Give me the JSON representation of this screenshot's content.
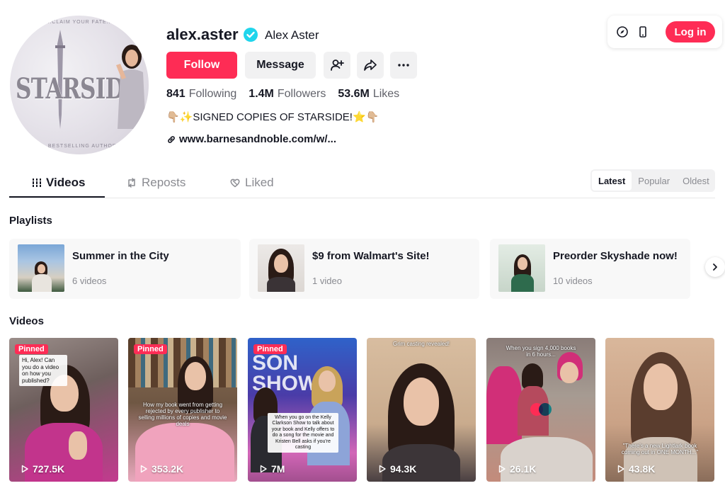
{
  "profile": {
    "username": "alex.aster",
    "nickname": "Alex Aster",
    "avatar_text": {
      "top": "...CLAIM YOUR FATE...",
      "title": "STARSIDE",
      "bottom": "...BESTSELLING AUTHOR"
    },
    "verified_icon": "verified-badge-icon",
    "follow_label": "Follow",
    "message_label": "Message",
    "stats": [
      {
        "value": "841",
        "label": "Following"
      },
      {
        "value": "1.4M",
        "label": "Followers"
      },
      {
        "value": "53.6M",
        "label": "Likes"
      }
    ],
    "bio": "👇🏼✨SIGNED COPIES OF STARSIDE!⭐👇🏼",
    "link": "www.barnesandnoble.com/w/..."
  },
  "topbar": {
    "login_label": "Log in"
  },
  "tabs": [
    {
      "label": "Videos",
      "active": true
    },
    {
      "label": "Reposts",
      "active": false
    },
    {
      "label": "Liked",
      "active": false
    }
  ],
  "sort": [
    {
      "label": "Latest",
      "active": true
    },
    {
      "label": "Popular",
      "active": false
    },
    {
      "label": "Oldest",
      "active": false
    }
  ],
  "sections": {
    "playlists": "Playlists",
    "videos": "Videos"
  },
  "playlists": [
    {
      "name": "Summer in the City",
      "count": "6 videos"
    },
    {
      "name": "$9 from Walmart's Site!",
      "count": "1 video"
    },
    {
      "name": "Preorder Skyshade now!",
      "count": "10 videos"
    }
  ],
  "videos": [
    {
      "views": "727.5K",
      "pinned": "Pinned",
      "caption": "Hi, Alex! Can you do a video on how you published?"
    },
    {
      "views": "353.2K",
      "pinned": "Pinned",
      "caption": "How my book went from getting rejected by every publisher to selling millions of copies and movie deals"
    },
    {
      "views": "7M",
      "pinned": "Pinned",
      "caption": "When you go on the Kelly Clarkson Show to talk about your book and Kelly offers to do a song for the movie and Kristen Bell asks if you're casting",
      "bg_text": "SON SHOW"
    },
    {
      "views": "94.3K",
      "caption": "Grim casting revealed!"
    },
    {
      "views": "26.1K",
      "caption": "When you sign 4,000 books in 6 hours..."
    },
    {
      "views": "43.8K",
      "caption": "\"There's a new Lightlark book coming out in ONE MONTH...\""
    }
  ],
  "colors": {
    "brand": "#fe2c55",
    "verified": "#20d5ec",
    "text": "#161823",
    "muted": "#8a8b91"
  }
}
